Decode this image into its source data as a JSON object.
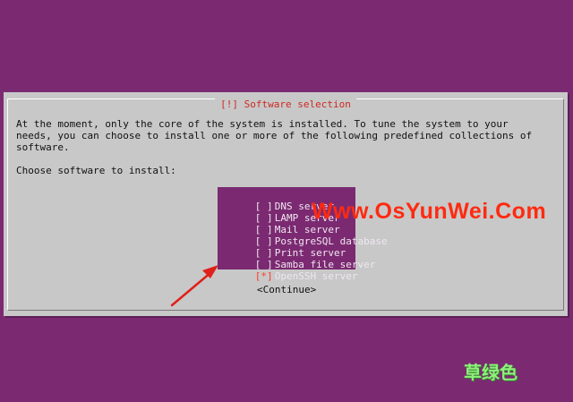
{
  "dialog": {
    "title": "[!] Software selection",
    "intro_lines": [
      "At the moment, only the core of the system is installed. To tune the system to your",
      "needs, you can choose to install one or more of the following predefined collections of",
      "software."
    ],
    "prompt": "Choose software to install:",
    "options": [
      {
        "checkbox": "[ ]",
        "label": "DNS server",
        "checked": false
      },
      {
        "checkbox": "[ ]",
        "label": "LAMP server",
        "checked": false
      },
      {
        "checkbox": "[ ]",
        "label": "Mail server",
        "checked": false
      },
      {
        "checkbox": "[ ]",
        "label": "PostgreSQL database",
        "checked": false
      },
      {
        "checkbox": "[ ]",
        "label": "Print server",
        "checked": false
      },
      {
        "checkbox": "[ ]",
        "label": "Samba file server",
        "checked": false
      },
      {
        "checkbox": "[*]",
        "label": "OpenSSH server",
        "checked": true
      }
    ],
    "continue_label": "<Continue>"
  },
  "watermark": {
    "text": "Www.OsYunWei.Com",
    "color": "#ff2a10"
  },
  "logo": {
    "text": "草绿色"
  },
  "colors": {
    "background": "#7b2a72",
    "dialog": "#c8c8c8",
    "title": "#cc2a22",
    "arrow": "#e0201a"
  },
  "annotation": {
    "icon": "red-arrow-icon"
  }
}
